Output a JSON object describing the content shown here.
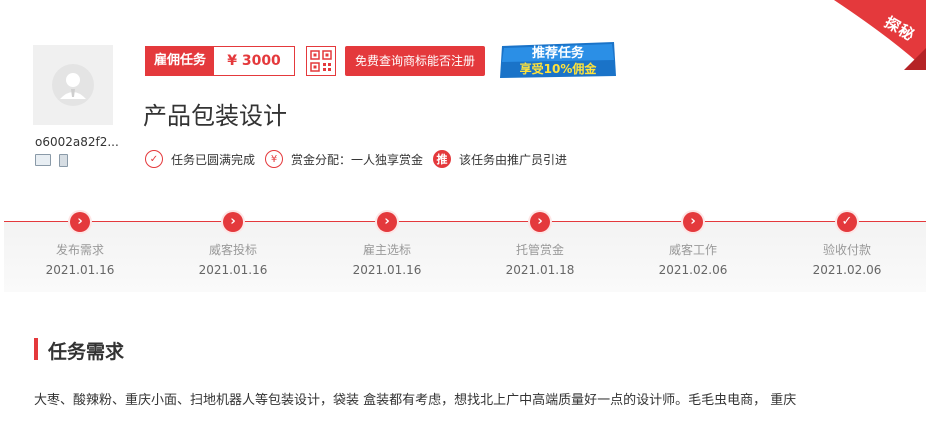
{
  "ribbon": {
    "label": "探秘"
  },
  "user": {
    "name": "o6002a82f2..."
  },
  "task": {
    "type_label": "雇佣任务",
    "price": "¥ 3000",
    "check_button": "免费查询商标能否注册",
    "promo_line1": "推荐任务",
    "promo_line2": "享受10%佣金",
    "title": "产品包装设计"
  },
  "features": [
    {
      "icon": "✓",
      "label": "任务已圆满完成"
    },
    {
      "icon": "¥",
      "label": "赏金分配：一人独享赏金"
    },
    {
      "icon": "推",
      "label": "该任务由推广员引进"
    }
  ],
  "steps": [
    {
      "icon": "›",
      "name": "发布需求",
      "date": "2021.01.16"
    },
    {
      "icon": "›",
      "name": "威客投标",
      "date": "2021.01.16"
    },
    {
      "icon": "›",
      "name": "雇主选标",
      "date": "2021.01.16"
    },
    {
      "icon": "›",
      "name": "托管赏金",
      "date": "2021.01.18"
    },
    {
      "icon": "›",
      "name": "威客工作",
      "date": "2021.02.06"
    },
    {
      "icon": "✓",
      "name": "验收付款",
      "date": "2021.02.06"
    }
  ],
  "section": {
    "title": "任务需求",
    "description": "大枣、酸辣粉、重庆小面、扫地机器人等包装设计，袋装  盒装都有考虑，想找北上广中高端质量好一点的设计师。毛毛虫电商，  重庆"
  },
  "colors": {
    "accent": "#e4393c"
  }
}
